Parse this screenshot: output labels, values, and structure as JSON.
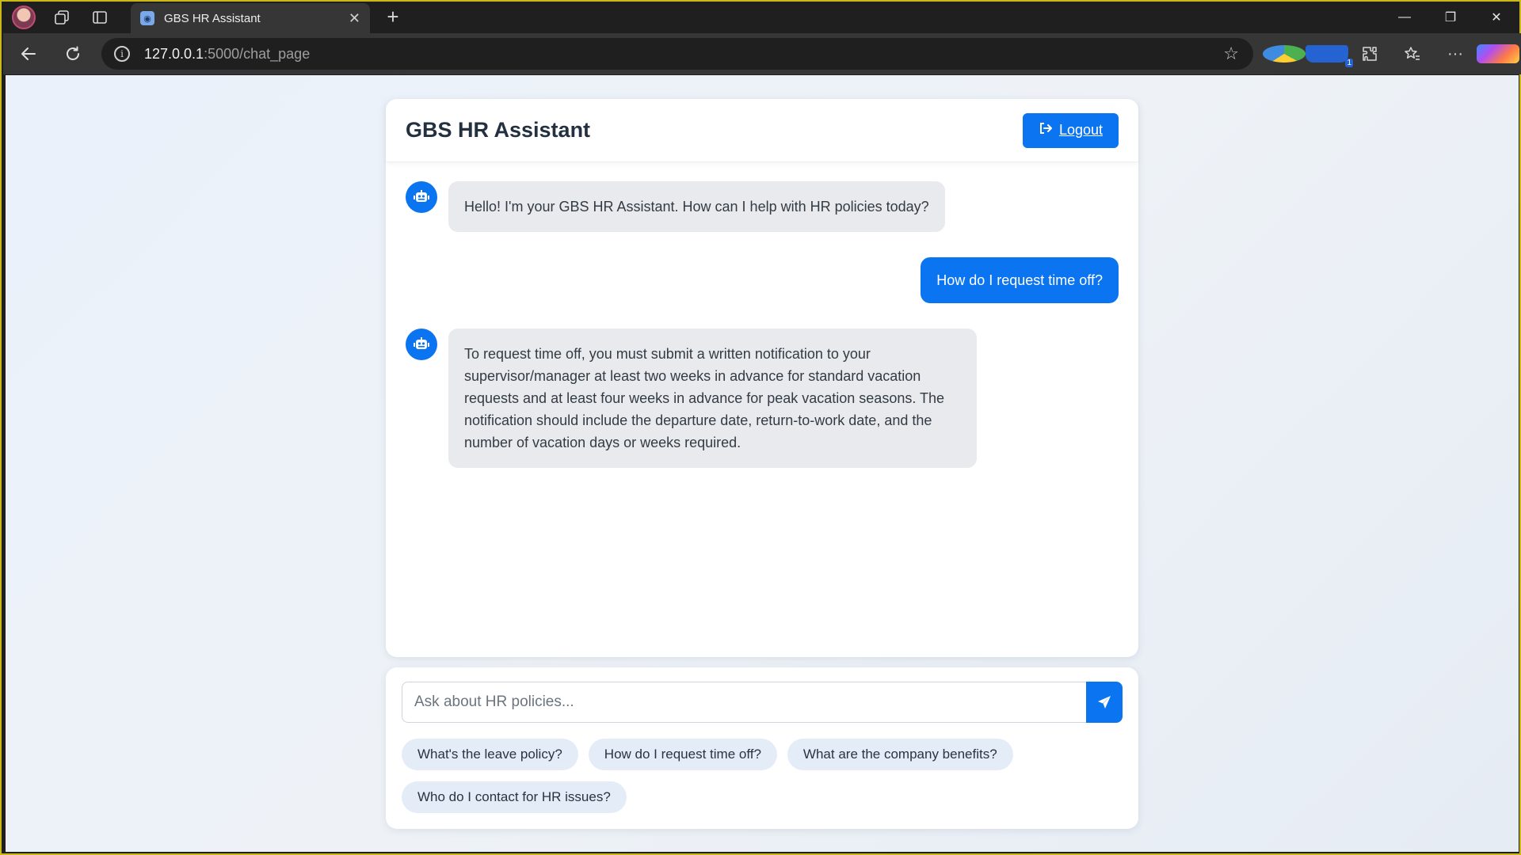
{
  "browser": {
    "tab_title": "GBS HR Assistant",
    "url_host": "127.0.0.1",
    "url_path": ":5000/chat_page",
    "tab_close": "✕",
    "new_tab": "+",
    "icons": [
      "profile-avatar",
      "workspaces-icon",
      "tab-actions-icon",
      "back-arrow-icon",
      "refresh-icon",
      "info-icon",
      "star-icon",
      "extension-icon",
      "favorites-icon",
      "more-icon",
      "copilot-icon"
    ]
  },
  "header": {
    "title": "GBS HR Assistant",
    "logout_label": "Logout"
  },
  "messages": [
    {
      "role": "bot",
      "text": "Hello! I'm your GBS HR Assistant. How can I help with HR policies today?"
    },
    {
      "role": "user",
      "text": "How do I request time off?"
    },
    {
      "role": "bot",
      "text": "To request time off, you must submit a written notification to your supervisor/manager at least two weeks in advance for standard vacation requests and at least four weeks in advance for peak vacation seasons. The notification should include the departure date, return-to-work date, and the number of vacation days or weeks required."
    }
  ],
  "input": {
    "placeholder": "Ask about HR policies...",
    "value": ""
  },
  "suggestions": [
    "What's the leave policy?",
    "How do I request time off?",
    "What are the company benefits?",
    "Who do I contact for HR issues?"
  ],
  "colors": {
    "accent": "#0b74f1",
    "bot_bubble": "#e8eaed",
    "chip_bg": "#e3ecf7",
    "page_bg": "#eaf1fa"
  }
}
